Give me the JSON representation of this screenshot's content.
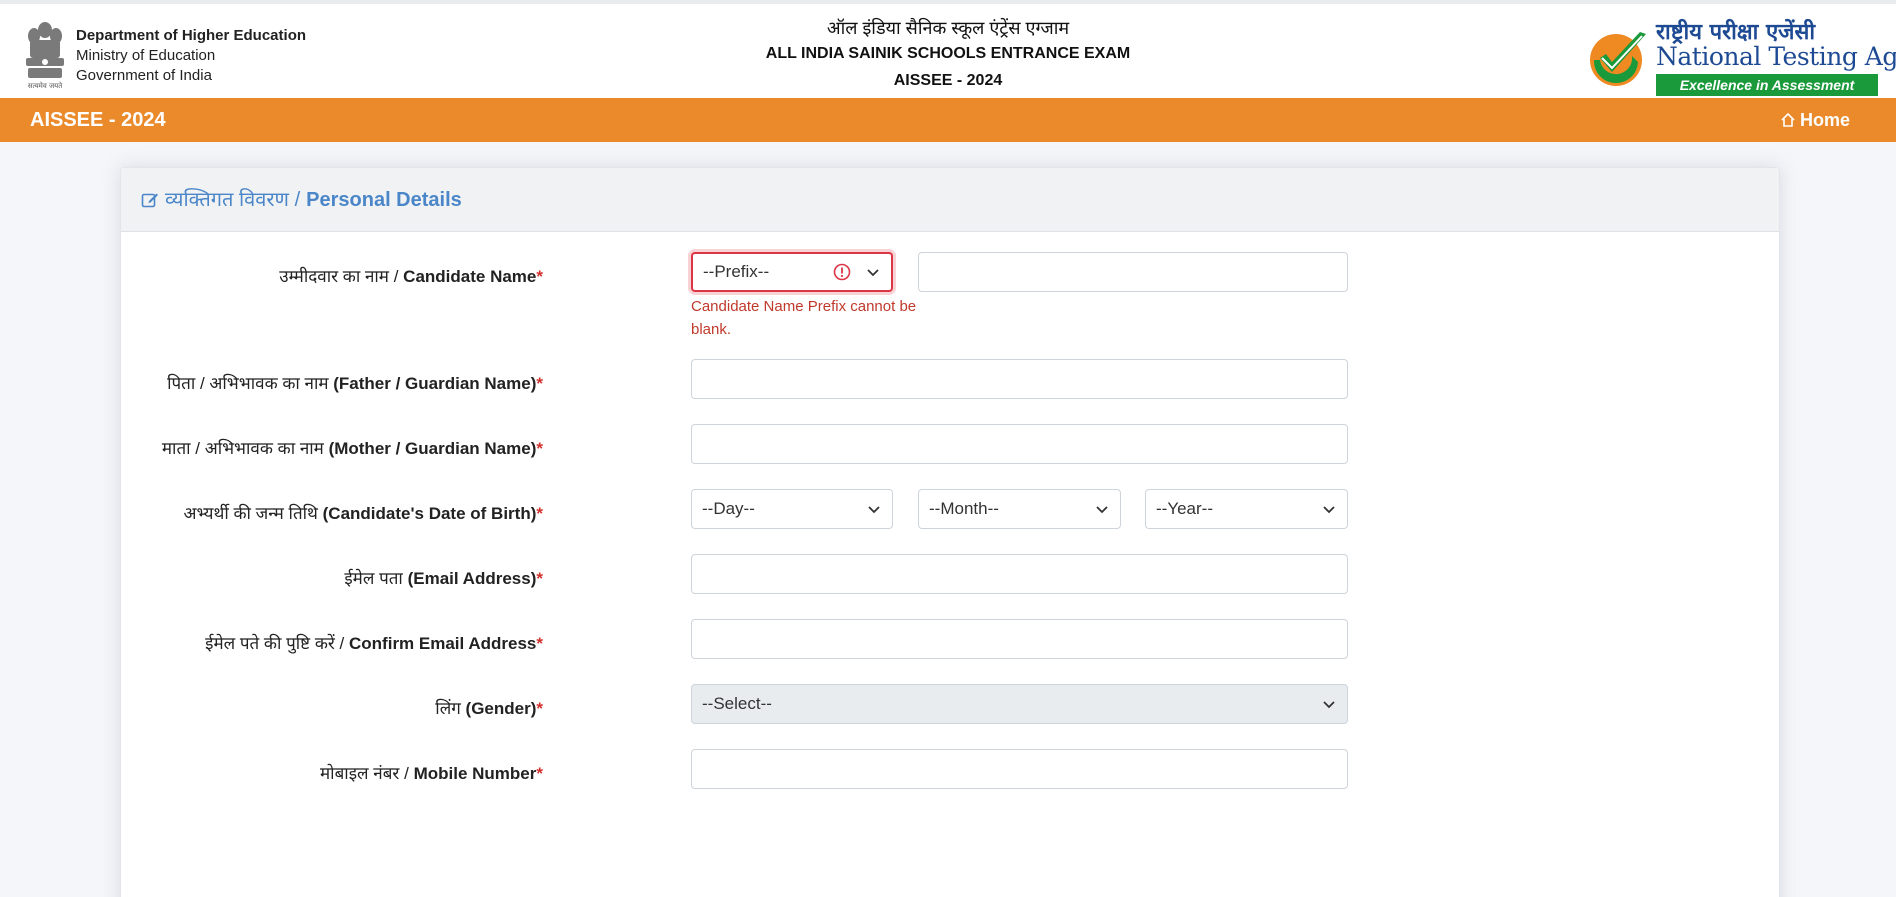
{
  "header": {
    "dept_line1": "Department of Higher Education",
    "dept_line2": "Ministry of Education",
    "dept_line3": "Government of India",
    "title_hi": "ऑल इंडिया सैनिक स्कूल एंट्रेंस एग्जाम",
    "title_en": "ALL INDIA SAINIK SCHOOLS ENTRANCE EXAM",
    "title_code": "AISSEE - 2024",
    "nta_hi": "राष्ट्रीय परीक्षा एजेंसी",
    "nta_en": "National Testing Agency",
    "nta_tagline": "Excellence in Assessment",
    "emblem_caption": "सत्यमेव जयते"
  },
  "nav": {
    "brand": "AISSEE - 2024",
    "home_label": "Home",
    "home_icon": "home-icon"
  },
  "colors": {
    "nav_bg": "#ea8a2b",
    "section_title": "#4a86c8",
    "required": "#d0312d",
    "error": "#dc3545",
    "nta_green": "#1a9a3a",
    "nta_blue": "#1e4a94"
  },
  "section": {
    "icon": "edit-icon",
    "title_hi": "व्यक्तिगत विवरण /",
    "title_en": "Personal Details"
  },
  "form": {
    "candidate_name": {
      "label_hi": "उम्मीदवार का नाम /",
      "label_en": "Candidate Name",
      "required": "*",
      "prefix_value": "--Prefix--",
      "name_value": "",
      "error": "Candidate Name Prefix cannot be blank."
    },
    "father_name": {
      "label_hi": "पिता / अभिभावक का नाम",
      "label_en": "(Father / Guardian Name)",
      "required": "*",
      "value": ""
    },
    "mother_name": {
      "label_hi": "माता / अभिभावक का नाम",
      "label_en": "(Mother / Guardian Name)",
      "required": "*",
      "value": ""
    },
    "dob": {
      "label_hi": "अभ्यर्थी की जन्म तिथि",
      "label_en": "(Candidate's Date of Birth)",
      "required": "*",
      "day": "--Day--",
      "month": "--Month--",
      "year": "--Year--"
    },
    "email": {
      "label_hi": "ईमेल पता",
      "label_en": "(Email Address)",
      "required": "*",
      "value": ""
    },
    "confirm_email": {
      "label_hi": "ईमेल पते की पुष्टि करें /",
      "label_en": "Confirm Email Address",
      "required": "*",
      "value": ""
    },
    "gender": {
      "label_hi": "लिंग",
      "label_en": "(Gender)",
      "required": "*",
      "value": "--Select--"
    },
    "mobile": {
      "label_hi": "मोबाइल नंबर /",
      "label_en": "Mobile Number",
      "required": "*",
      "value": ""
    }
  }
}
